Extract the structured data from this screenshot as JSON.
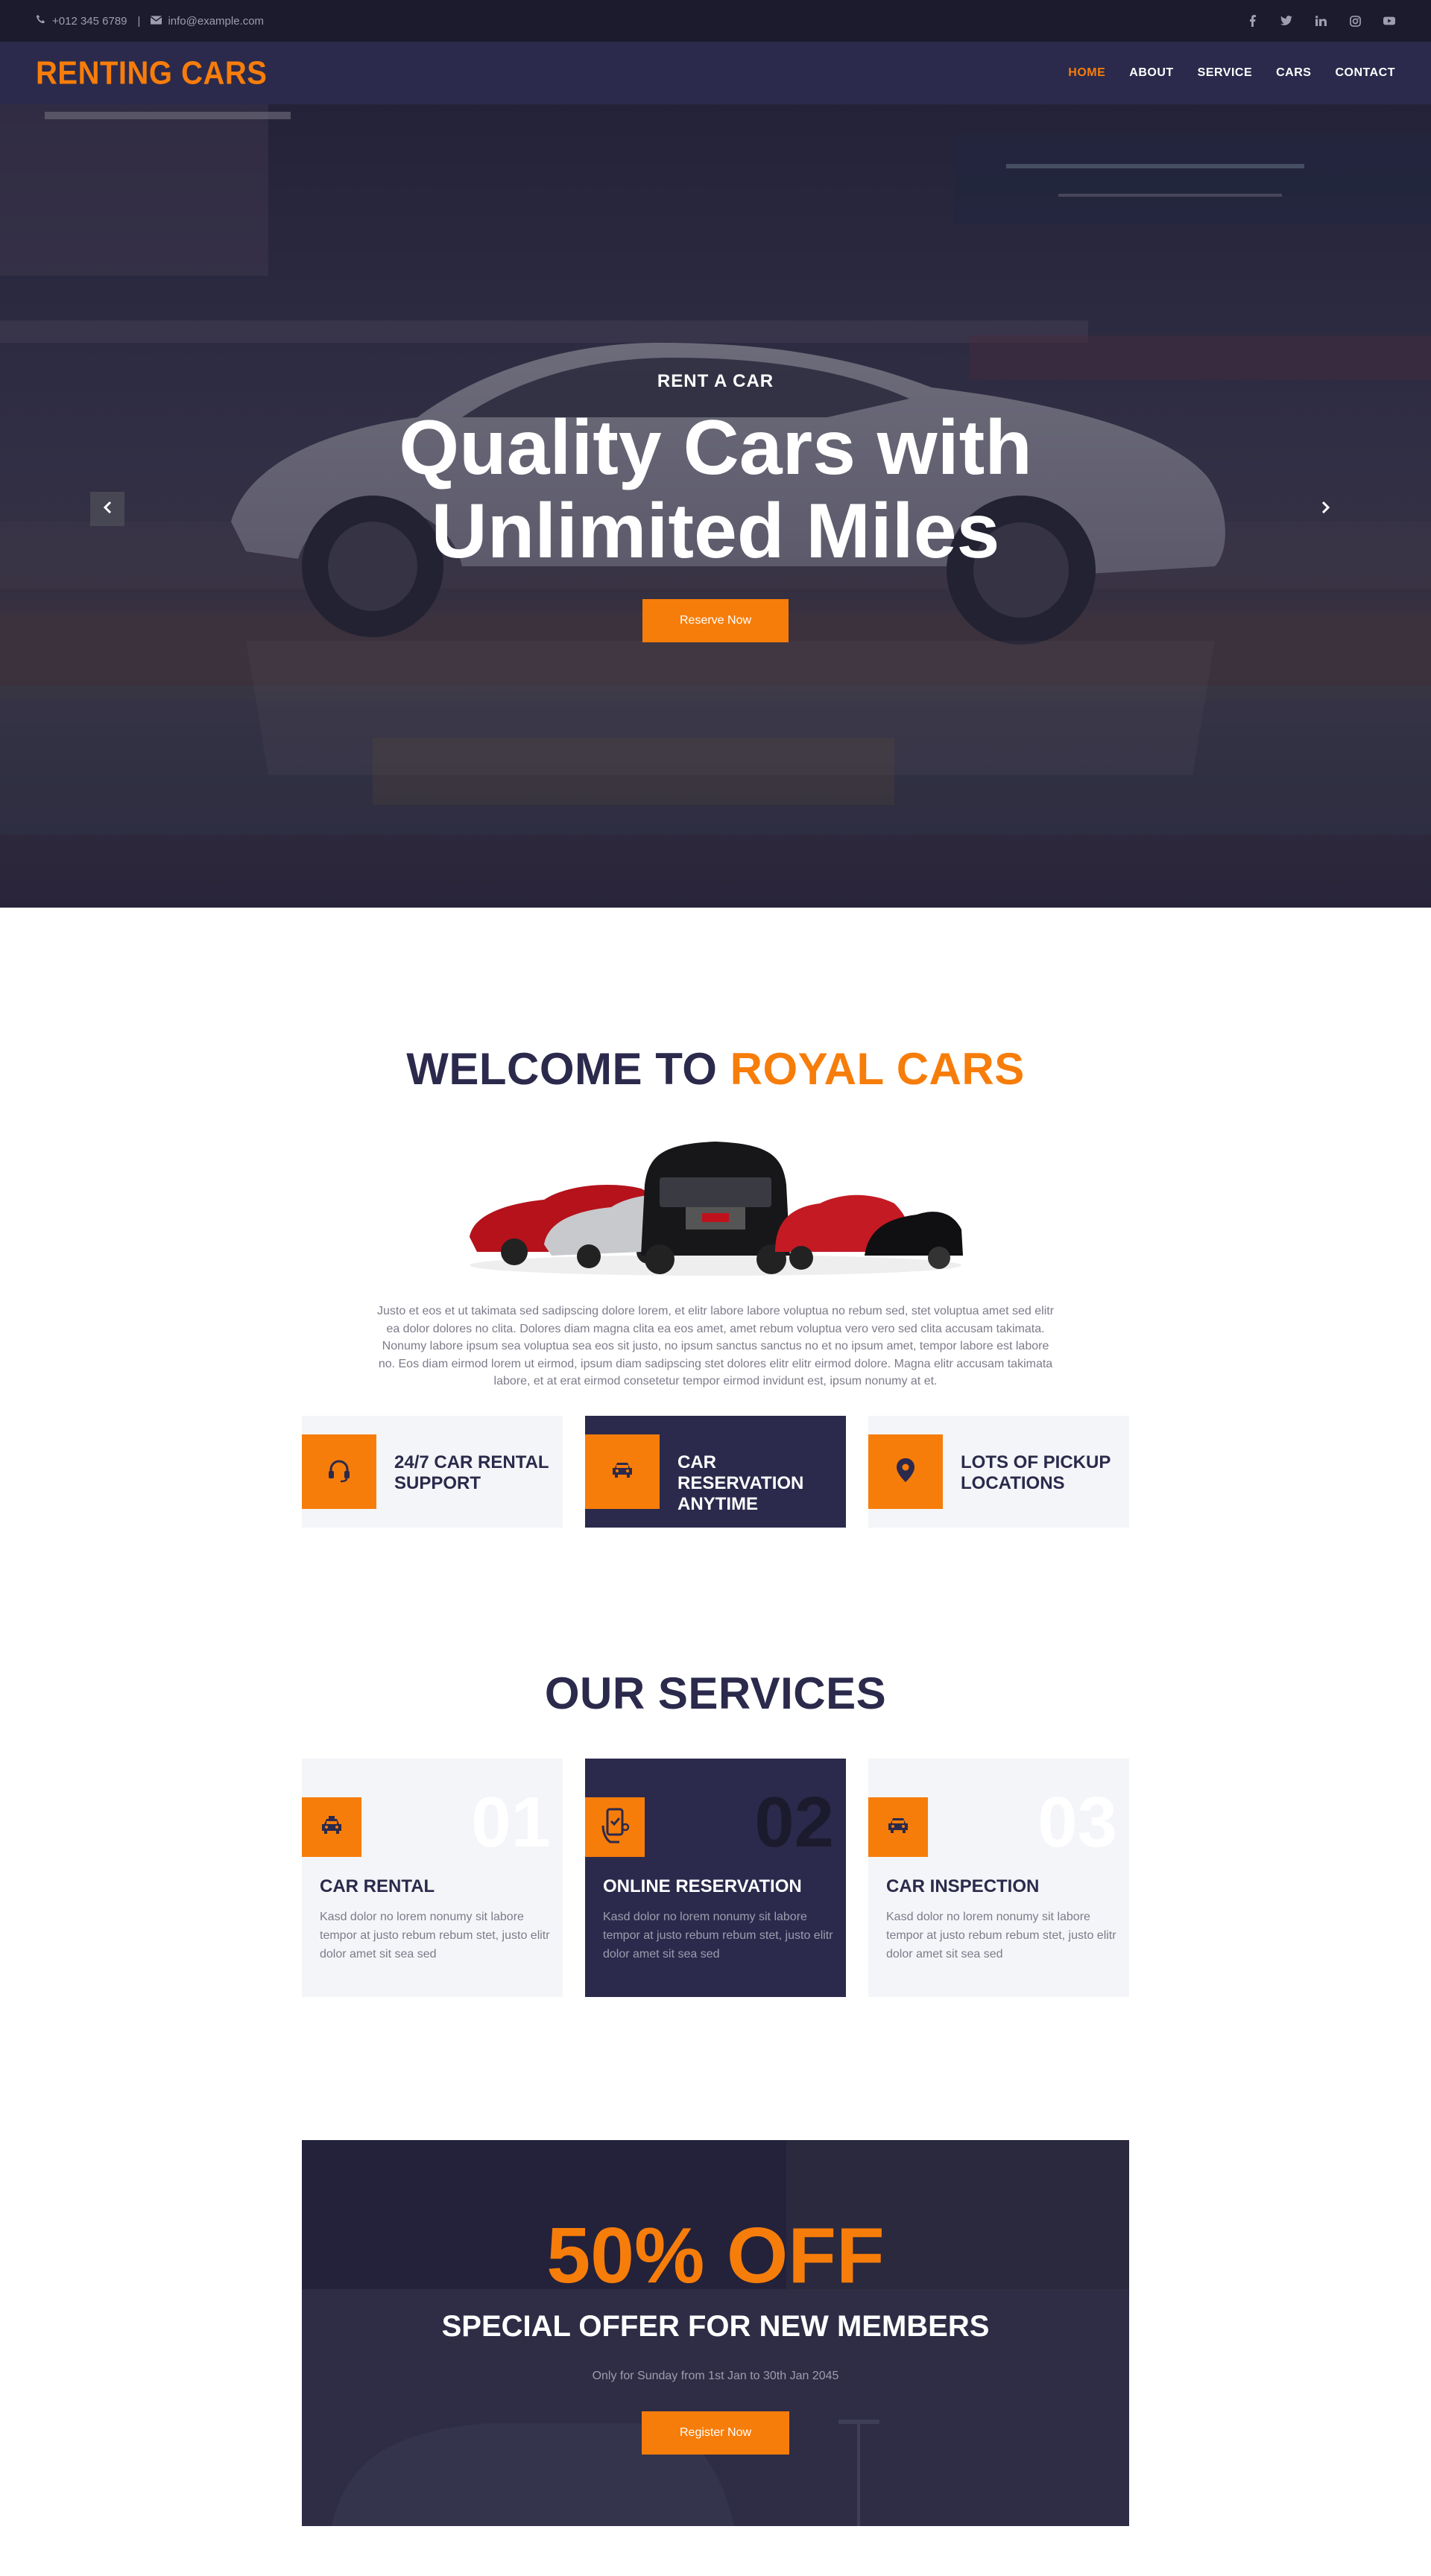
{
  "topbar": {
    "phone": "+012 345 6789",
    "separator": "|",
    "email": "info@example.com",
    "social": [
      "facebook-icon",
      "twitter-icon",
      "linkedin-icon",
      "instagram-icon",
      "youtube-icon"
    ]
  },
  "navbar": {
    "brand": "RENTING CARS",
    "links": [
      {
        "label": "HOME",
        "active": true
      },
      {
        "label": "ABOUT",
        "active": false
      },
      {
        "label": "SERVICE",
        "active": false
      },
      {
        "label": "CARS",
        "active": false
      },
      {
        "label": "CONTACT",
        "active": false
      }
    ]
  },
  "hero": {
    "subtitle": "RENT A CAR",
    "title_line1": "Quality Cars with",
    "title_line2": "Unlimited Miles",
    "button": "Reserve Now",
    "prev_icon": "chevron-left-icon",
    "next_icon": "chevron-right-icon"
  },
  "welcome": {
    "title_prefix": "WELCOME TO",
    "title_accent": "ROYAL CARS",
    "text": "Justo et eos et ut takimata sed sadipscing dolore lorem, et elitr labore labore voluptua no rebum sed, stet voluptua amet sed elitr ea dolor dolores no clita. Dolores diam magna clita ea eos amet, amet rebum voluptua vero vero sed clita accusam takimata. Nonumy labore ipsum sea voluptua sea eos sit justo, no ipsum sanctus sanctus no et no ipsum amet, tempor labore est labore no. Eos diam eirmod lorem ut eirmod, ipsum diam sadipscing stet dolores elitr elitr eirmod dolore. Magna elitr accusam takimata labore, et at erat eirmod consetetur tempor eirmod invidunt est, ipsum nonumy at et.",
    "features": [
      {
        "label_line1": "24/7 CAR RENTAL",
        "label_line2": "SUPPORT",
        "icon": "headset-icon"
      },
      {
        "label_line1": "CAR RESERVATION",
        "label_line2": "ANYTIME",
        "icon": "car-icon"
      },
      {
        "label_line1": "LOTS OF PICKUP",
        "label_line2": "LOCATIONS",
        "icon": "map-marker-icon"
      }
    ]
  },
  "services": {
    "title": "OUR SERVICES",
    "items": [
      {
        "num": "01",
        "title": "CAR RENTAL",
        "text": "Kasd dolor no lorem nonumy sit labore tempor at justo rebum rebum stet, justo elitr dolor amet sit sea sed",
        "icon": "taxi-icon"
      },
      {
        "num": "02",
        "title": "ONLINE RESERVATION",
        "text": "Kasd dolor no lorem nonumy sit labore tempor at justo rebum rebum stet, justo elitr dolor amet sit sea sed",
        "icon": "phone-booking-icon"
      },
      {
        "num": "03",
        "title": "CAR INSPECTION",
        "text": "Kasd dolor no lorem nonumy sit labore tempor at justo rebum rebum stet, justo elitr dolor amet sit sea sed",
        "icon": "car-icon"
      }
    ]
  },
  "offer": {
    "title": "50% OFF",
    "subtitle": "SPECIAL OFFER FOR NEW MEMBERS",
    "note": "Only for Sunday from 1st Jan to 30th Jan 2045",
    "button": "Register Now"
  },
  "colors": {
    "accent": "#f77d0a",
    "dark": "#2b2a4c",
    "darker": "#1c1b2e",
    "light_bg": "#f4f5f8"
  }
}
